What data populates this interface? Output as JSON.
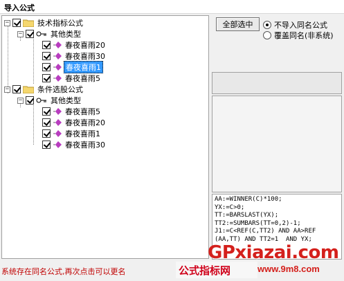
{
  "window": {
    "title": "导入公式"
  },
  "tree": {
    "groups": [
      {
        "label": "技术指标公式",
        "subgroup": "其他类型",
        "items": [
          "春夜喜雨20",
          "春夜喜雨30",
          "春夜喜雨1",
          "春夜喜雨5"
        ]
      },
      {
        "label": "条件选股公式",
        "subgroup": "其他类型",
        "items": [
          "春夜喜雨5",
          "春夜喜雨20",
          "春夜喜雨1",
          "春夜喜雨30"
        ]
      }
    ],
    "selected_item": "春夜喜雨1"
  },
  "options": {
    "select_all_label": "全部选中",
    "radio_skip": "不导入同名公式",
    "radio_overwrite": "覆盖同名(非系统)",
    "selected_radio": "radio_skip"
  },
  "code_preview": {
    "lines": [
      "AA:=WINNER(C)*100;",
      "YX:=C>0;",
      "TT:=BARSLAST(YX);",
      "TT2:=SUMBARS(TT=0,2)-1;",
      "J1:=C<REF(C,TT2) AND AA>REF",
      "(AA,TT) AND TT2=1  AND YX;"
    ]
  },
  "status_text": "系统存在同名公式,再次点击可以更名",
  "watermark": {
    "left_text": "公式指标网",
    "brand": "GPxiazai.com",
    "url": "www.9m8.com"
  },
  "colors": {
    "selection": "#3399ff",
    "status": "#c00000",
    "watermark": "#d4201c"
  }
}
